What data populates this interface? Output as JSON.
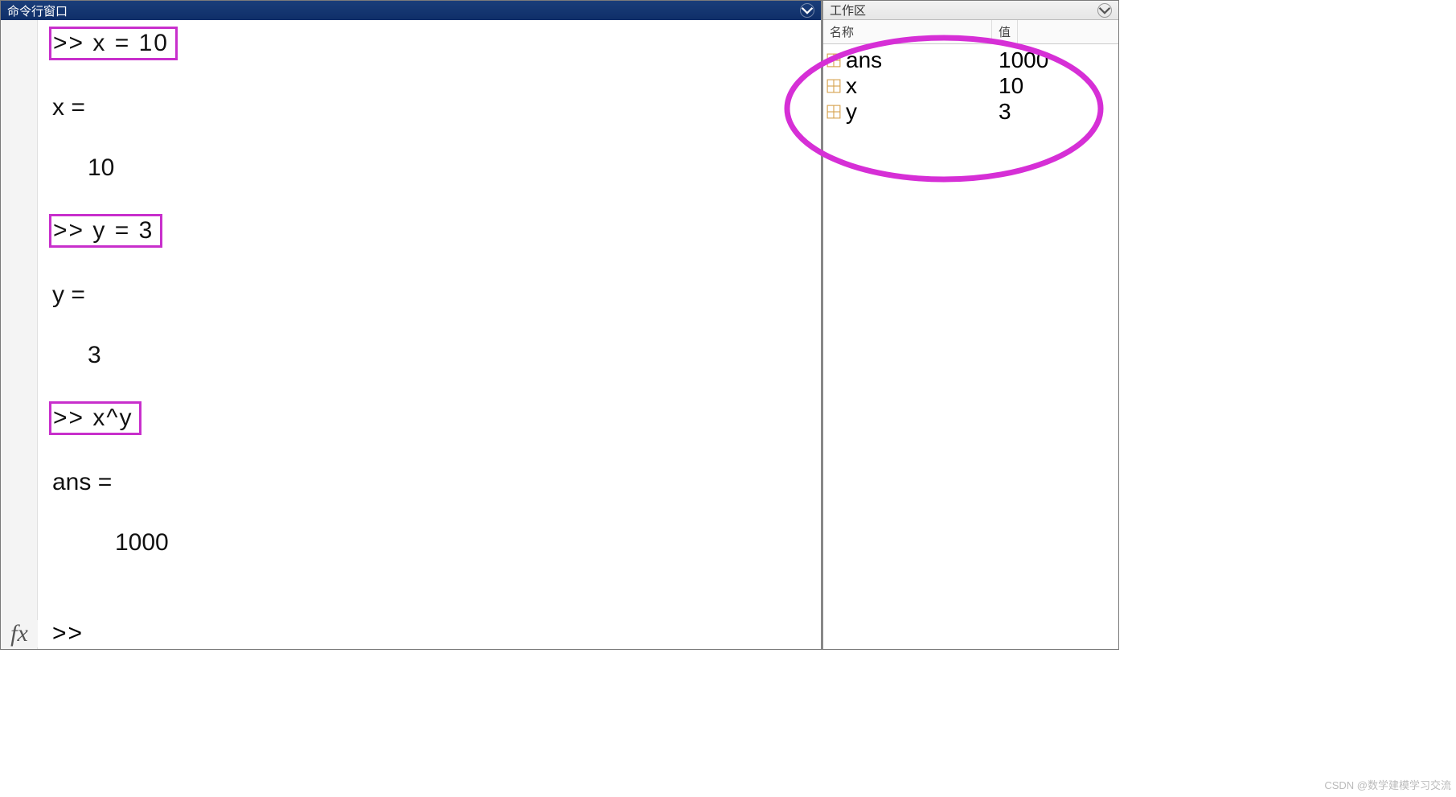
{
  "cmd": {
    "title": "命令行窗口",
    "lines": {
      "in1": ">> x = 10",
      "out1a": "x =",
      "out1b": "10",
      "in2": ">> y = 3",
      "out2a": "y =",
      "out2b": "3",
      "in3": ">> x^y",
      "out3a": "ans =",
      "out3b": "1000",
      "prompt": ">>"
    },
    "fx": "fx"
  },
  "workspace": {
    "title": "工作区",
    "columns": {
      "name": "名称",
      "value": "值"
    },
    "vars": [
      {
        "name": "ans",
        "value": "1000"
      },
      {
        "name": "x",
        "value": "10"
      },
      {
        "name": "y",
        "value": "3"
      }
    ]
  },
  "watermark": "CSDN @数学建模学习交流"
}
